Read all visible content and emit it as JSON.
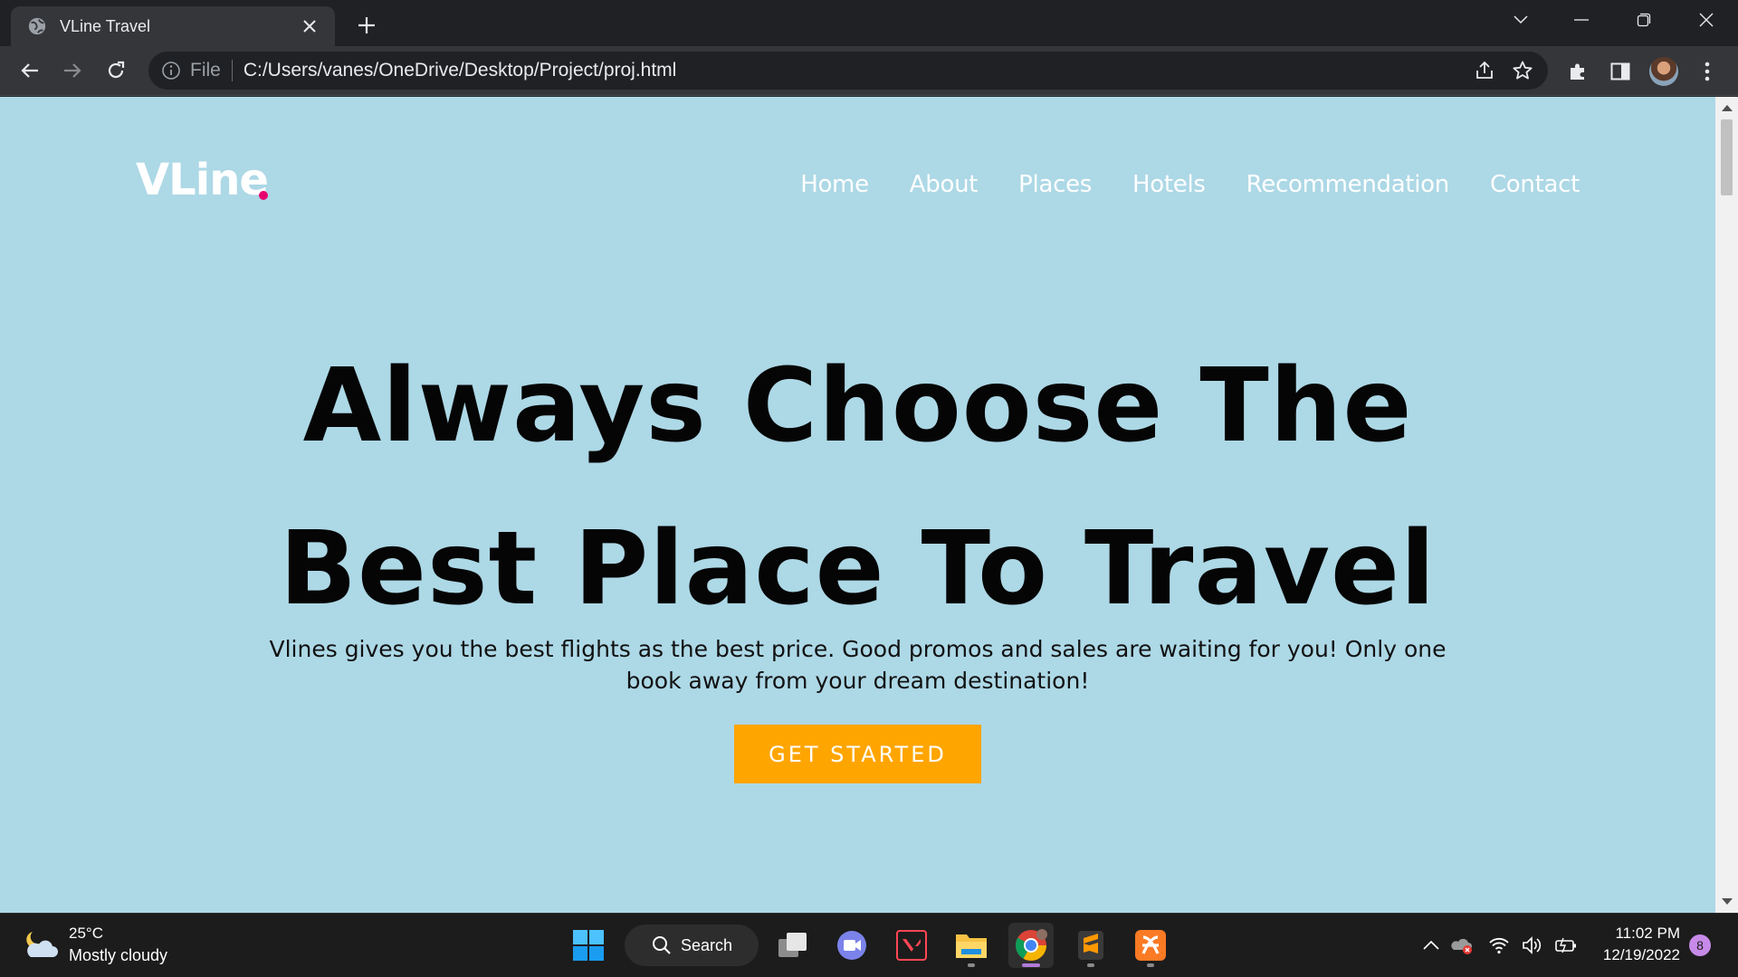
{
  "browser": {
    "tab_title": "VLine Travel",
    "address": {
      "scheme_label": "File",
      "url": "C:/Users/vanes/OneDrive/Desktop/Project/proj.html"
    }
  },
  "page": {
    "logo": "VLine",
    "nav": [
      "Home",
      "About",
      "Places",
      "Hotels",
      "Recommendation",
      "Contact"
    ],
    "hero": {
      "title_line1": "Always Choose The",
      "title_line2": "Best Place To Travel",
      "subtitle": "Vlines gives you the best flights as the best price. Good promos and sales are waiting for you! Only one book away from your dream destination!",
      "cta_label": "GET STARTED"
    },
    "colors": {
      "background": "#add8e6",
      "accent_dot": "#e6006e",
      "cta": "#ffa500"
    }
  },
  "taskbar": {
    "weather": {
      "temperature": "25°C",
      "description": "Mostly cloudy"
    },
    "search_label": "Search",
    "pinned_apps": [
      "start-menu-icon",
      "task-view-icon",
      "teams-chat-icon",
      "valorant-icon",
      "file-explorer-icon",
      "chrome-icon",
      "sublime-text-icon",
      "xampp-icon"
    ],
    "clock": {
      "time": "11:02 PM",
      "date": "12/19/2022"
    },
    "notification_count": "8"
  }
}
